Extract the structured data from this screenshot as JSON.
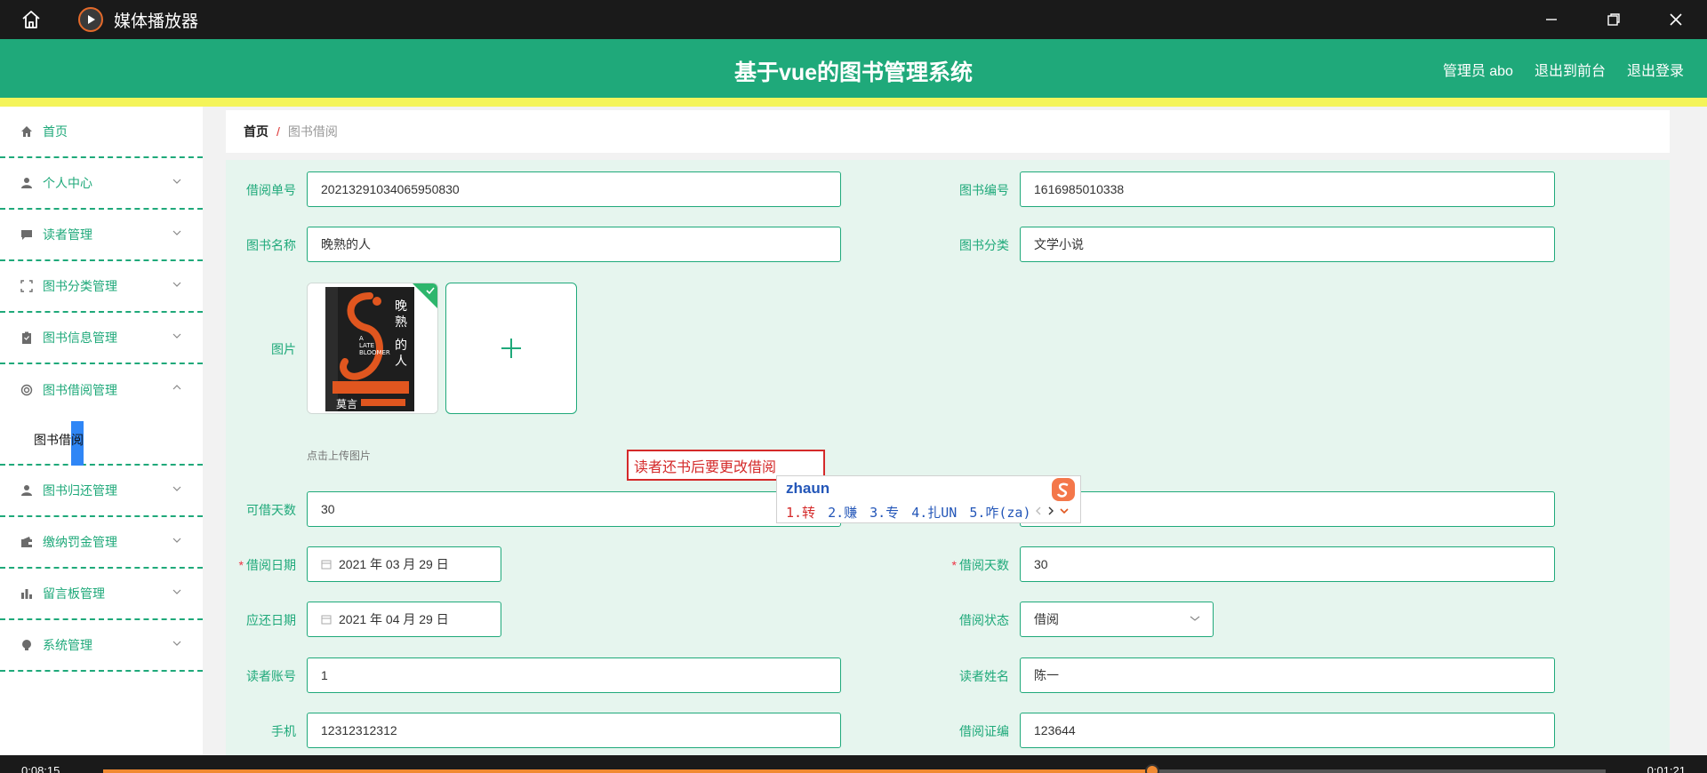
{
  "player": {
    "title": "媒体播放器",
    "elapsed": "0:08:15",
    "total": "0:01:21",
    "progress": 0.698
  },
  "header": {
    "app_title": "基于vue的图书管理系统",
    "admin": "管理员 abo",
    "to_front": "退出到前台",
    "logout": "退出登录"
  },
  "sidebar": {
    "items": [
      {
        "label": "首页",
        "icon": "home-icon"
      },
      {
        "label": "个人中心",
        "icon": "user-icon"
      },
      {
        "label": "读者管理",
        "icon": "chat-icon"
      },
      {
        "label": "图书分类管理",
        "icon": "frame-icon"
      },
      {
        "label": "图书信息管理",
        "icon": "clipboard-icon"
      },
      {
        "label": "图书借阅管理",
        "icon": "ring-icon"
      },
      {
        "label": "图书归还管理",
        "icon": "user-icon"
      },
      {
        "label": "缴纳罚金管理",
        "icon": "wallet-icon"
      },
      {
        "label": "留言板管理",
        "icon": "bar-chart-icon"
      },
      {
        "label": "系统管理",
        "icon": "bulb-icon"
      }
    ],
    "submenu": "图书借阅"
  },
  "breadcrumb": {
    "home": "首页",
    "separator": "/",
    "current": "图书借阅"
  },
  "form": {
    "borrow_no_label": "借阅单号",
    "borrow_no": "20213291034065950830",
    "book_no_label": "图书编号",
    "book_no": "1616985010338",
    "book_name_label": "图书名称",
    "book_name": "晚熟的人",
    "category_label": "图书分类",
    "category": "文学小说",
    "image_label": "图片",
    "upload_tip": "点击上传图片",
    "cover": {
      "title": "晚熟的人",
      "en_title": "A LATE BLOOMER",
      "author": "莫言"
    },
    "days_allowed_label": "可借天数",
    "days_allowed": "30",
    "borrow_date_label": "借阅日期",
    "borrow_date": "2021 年 03 月 29 日",
    "borrow_days_label": "借阅天数",
    "borrow_days": "30",
    "due_date_label": "应还日期",
    "due_date": "2021 年 04 月 29 日",
    "status_label": "借阅状态",
    "status": "借阅",
    "reader_account_label": "读者账号",
    "reader_account": "1",
    "reader_name_label": "读者姓名",
    "reader_name": "陈一",
    "phone_label": "手机",
    "phone": "12312312312",
    "card_label": "借阅证编",
    "card": "123644"
  },
  "annotation": "读者还书后要更改借阅",
  "ime": {
    "input": "zhaun",
    "candidates": [
      "1.转",
      "2.赚",
      "3.专",
      "4.扎UN",
      "5.咋(za)"
    ]
  },
  "colors": {
    "primary": "#1fa97a",
    "header_band": "#f4f45a",
    "annotation": "#d42a2a",
    "form_bg": "#e6f5ee"
  }
}
